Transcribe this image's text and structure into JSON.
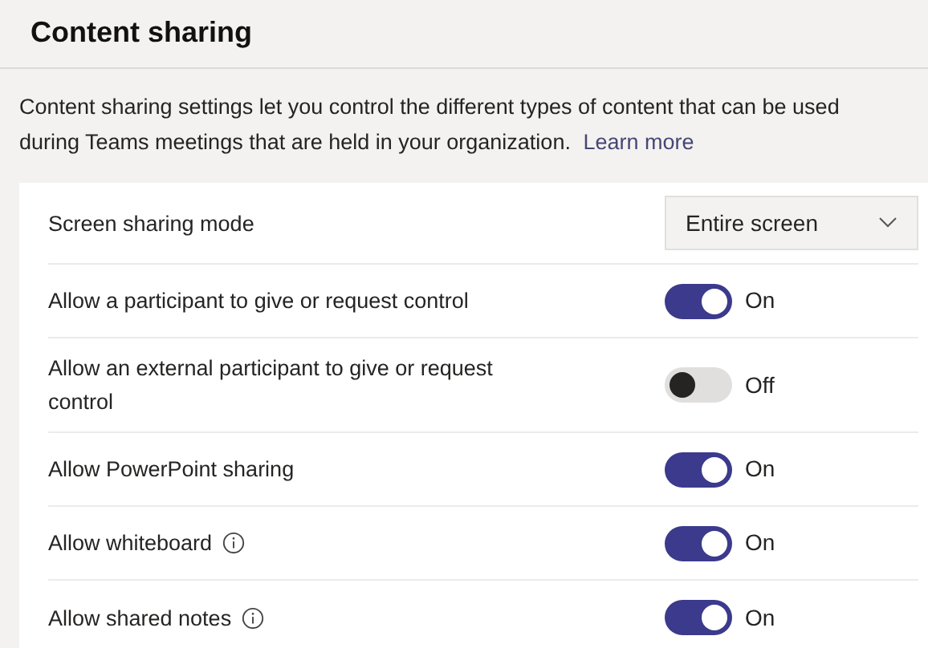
{
  "title": "Content sharing",
  "description": "Content sharing settings let you control the different types of content that can be used during Teams meetings that are held in your organization.",
  "learn_more": "Learn more",
  "settings": [
    {
      "kind": "dropdown",
      "label": "Screen sharing mode",
      "value": "Entire screen",
      "info": false
    },
    {
      "kind": "toggle",
      "label": "Allow a participant to give or request control",
      "on": true,
      "state_text": "On",
      "info": false
    },
    {
      "kind": "toggle",
      "label": "Allow an external participant to give or request control",
      "on": false,
      "state_text": "Off",
      "info": false
    },
    {
      "kind": "toggle",
      "label": "Allow PowerPoint sharing",
      "on": true,
      "state_text": "On",
      "info": false
    },
    {
      "kind": "toggle",
      "label": "Allow whiteboard",
      "on": true,
      "state_text": "On",
      "info": true
    },
    {
      "kind": "toggle",
      "label": "Allow shared notes",
      "on": true,
      "state_text": "On",
      "info": true
    }
  ]
}
